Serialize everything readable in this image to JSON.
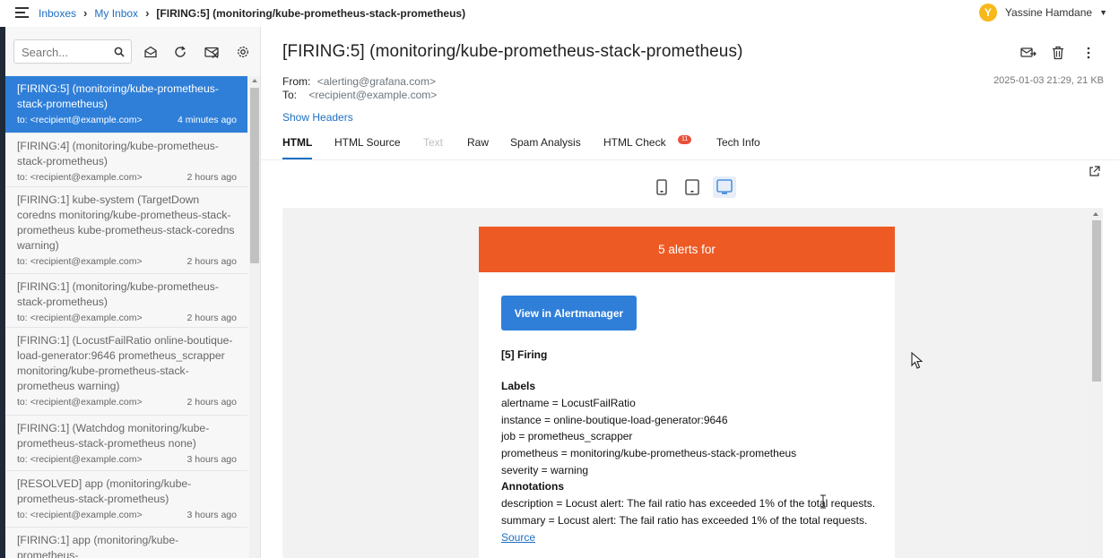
{
  "breadcrumb": {
    "items": [
      "Inboxes",
      "My Inbox"
    ],
    "current": "[FIRING:5] (monitoring/kube-prometheus-stack-prometheus)"
  },
  "user": {
    "initial": "Y",
    "name": "Yassine Hamdane"
  },
  "sidebar": {
    "search": {
      "placeholder": "Search..."
    },
    "toolbar_icons": [
      "mark-read-icon",
      "refresh-icon",
      "delete-all-icon",
      "settings-icon"
    ],
    "messages": [
      {
        "subject": "[FIRING:5] (monitoring/kube-prometheus-stack-prometheus)",
        "to": "to: <recipient@example.com>",
        "time": "4 minutes ago",
        "active": true
      },
      {
        "subject": "[FIRING:4] (monitoring/kube-prometheus-stack-prometheus)",
        "to": "to: <recipient@example.com>",
        "time": "2 hours ago"
      },
      {
        "subject": "[FIRING:1] kube-system (TargetDown coredns monitoring/kube-prometheus-stack-prometheus kube-prometheus-stack-coredns warning)",
        "to": "to: <recipient@example.com>",
        "time": "2 hours ago"
      },
      {
        "subject": "[FIRING:1] (monitoring/kube-prometheus-stack-prometheus)",
        "to": "to: <recipient@example.com>",
        "time": "2 hours ago"
      },
      {
        "subject": "[FIRING:1] (LocustFailRatio online-boutique-load-generator:9646 prometheus_scrapper monitoring/kube-prometheus-stack-prometheus warning)",
        "to": "to: <recipient@example.com>",
        "time": "2 hours ago"
      },
      {
        "subject": "[FIRING:1] (Watchdog monitoring/kube-prometheus-stack-prometheus none)",
        "to": "to: <recipient@example.com>",
        "time": "3 hours ago"
      },
      {
        "subject": "[RESOLVED] app (monitoring/kube-prometheus-stack-prometheus)",
        "to": "to: <recipient@example.com>",
        "time": "3 hours ago"
      },
      {
        "subject": "[FIRING:1] app (monitoring/kube-prometheus-",
        "to": "",
        "time": ""
      }
    ]
  },
  "message": {
    "title": "[FIRING:5] (monitoring/kube-prometheus-stack-prometheus)",
    "from_label": "From:",
    "from": "<alerting@grafana.com>",
    "to_label": "To:",
    "to": "<recipient@example.com>",
    "date_size": "2025-01-03 21:29, 21 KB",
    "show_headers": "Show Headers",
    "tabs": [
      {
        "label": "HTML",
        "state": "active"
      },
      {
        "label": "HTML Source"
      },
      {
        "label": "Text",
        "state": "disabled"
      },
      {
        "label": "Raw"
      },
      {
        "label": "Spam Analysis"
      },
      {
        "label": "HTML Check",
        "badge": "11"
      },
      {
        "label": "Tech Info"
      }
    ],
    "header_icons": [
      "forward-icon",
      "trash-icon",
      "more-vertical-icon"
    ],
    "device_views": [
      "mobile-view-icon",
      "tablet-view-icon",
      "desktop-view-icon"
    ],
    "active_device": "desktop"
  },
  "email": {
    "banner": "5 alerts for",
    "button": "View in Alertmanager",
    "firing_heading": "[5] Firing",
    "labels_heading": "Labels",
    "labels": [
      "alertname = LocustFailRatio",
      "instance = online-boutique-load-generator:9646",
      "job = prometheus_scrapper",
      "prometheus = monitoring/kube-prometheus-stack-prometheus",
      "severity = warning"
    ],
    "annotations_heading": "Annotations",
    "annotations": [
      "description = Locust alert: The fail ratio has exceeded 1% of the total requests.",
      "summary = Locust alert: The fail ratio has exceeded 1% of the total requests."
    ],
    "source_link": "Source"
  },
  "colors": {
    "accent": "#2f7fd9",
    "banner": "#ee5a24",
    "badge": "#e8503a",
    "avatar": "#f6b81a"
  }
}
